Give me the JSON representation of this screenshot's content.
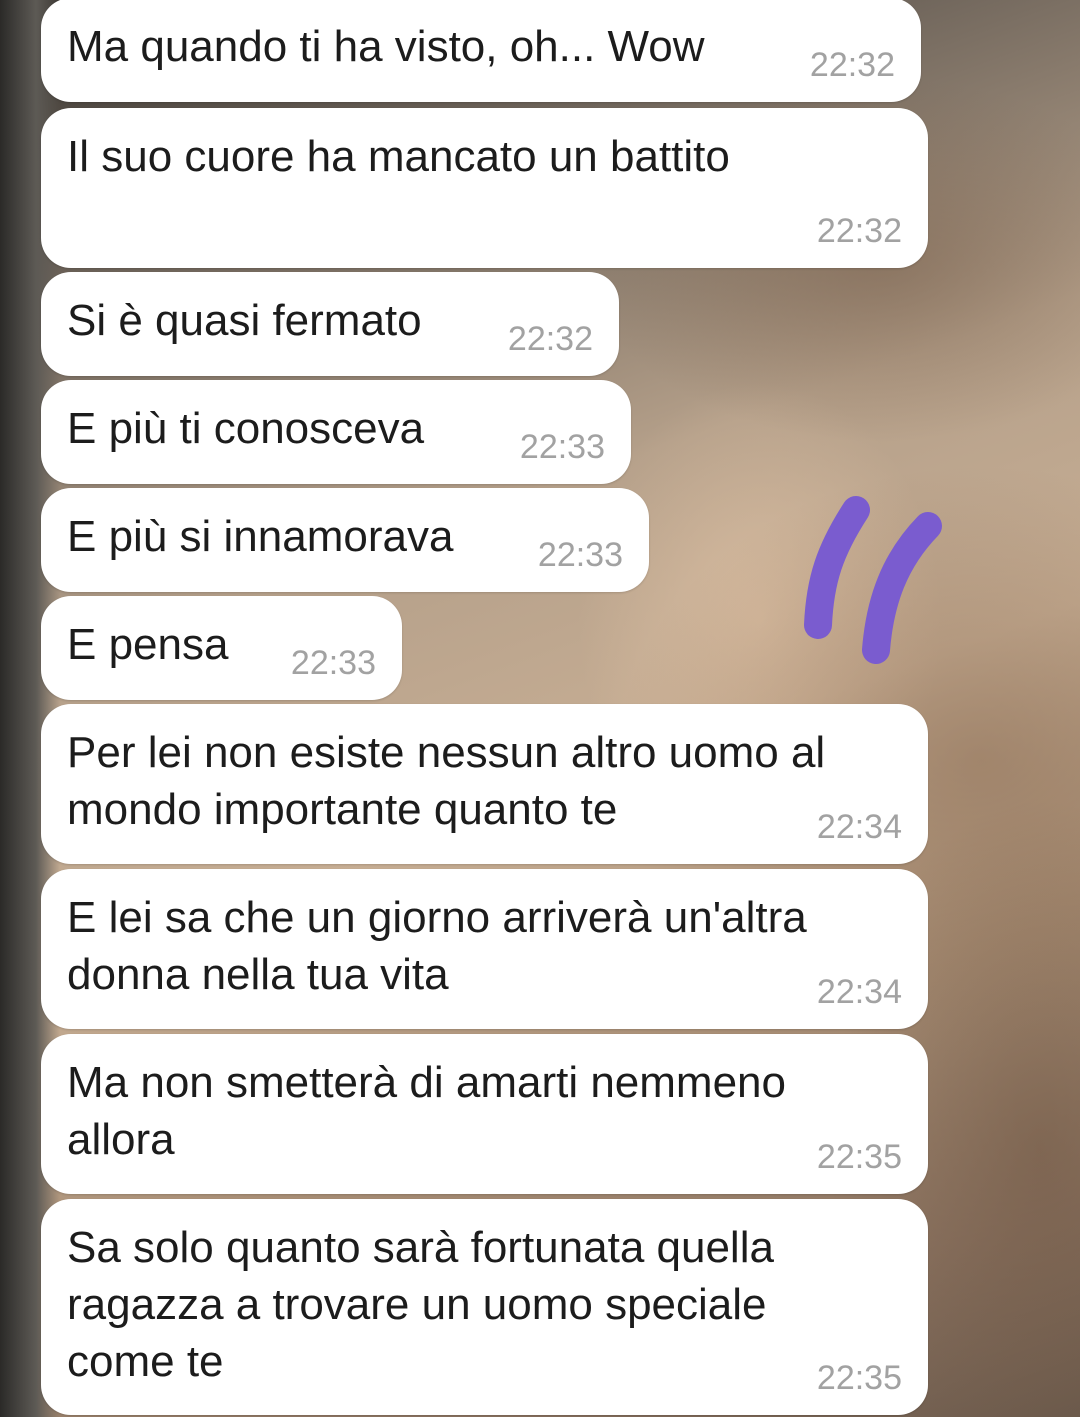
{
  "background": {
    "description_colors": [
      "#3a3631",
      "#b5a08a",
      "#c7ae94",
      "#8a7260"
    ]
  },
  "accent": {
    "quote_color": "#7a5ccf",
    "bubble_color": "#ffffff",
    "text_color": "#1c1c1c",
    "time_color": "#a2a2a2"
  },
  "decoration": {
    "quote_icon": "handwritten-double-quote-icon"
  },
  "messages": [
    {
      "text": "Ma quando ti ha visto, oh... Wow",
      "time": "22:32"
    },
    {
      "text": "Il suo cuore ha mancato un battito",
      "time": "22:32"
    },
    {
      "text": "Si è quasi fermato",
      "time": "22:32"
    },
    {
      "text": "E più ti conosceva",
      "time": "22:33"
    },
    {
      "text": "E più si innamorava",
      "time": "22:33"
    },
    {
      "text": "E pensa",
      "time": "22:33"
    },
    {
      "text": "Per lei non esiste nessun altro uomo al\nmondo importante quanto te",
      "time": "22:34"
    },
    {
      "text": "E lei sa che un giorno arriverà un'altra\ndonna nella tua vita",
      "time": "22:34"
    },
    {
      "text": "Ma non smetterà di amarti nemmeno\nallora",
      "time": "22:35"
    },
    {
      "text": "Sa solo quanto sarà fortunata quella\nragazza a trovare un uomo speciale\ncome te",
      "time": "22:35"
    }
  ]
}
